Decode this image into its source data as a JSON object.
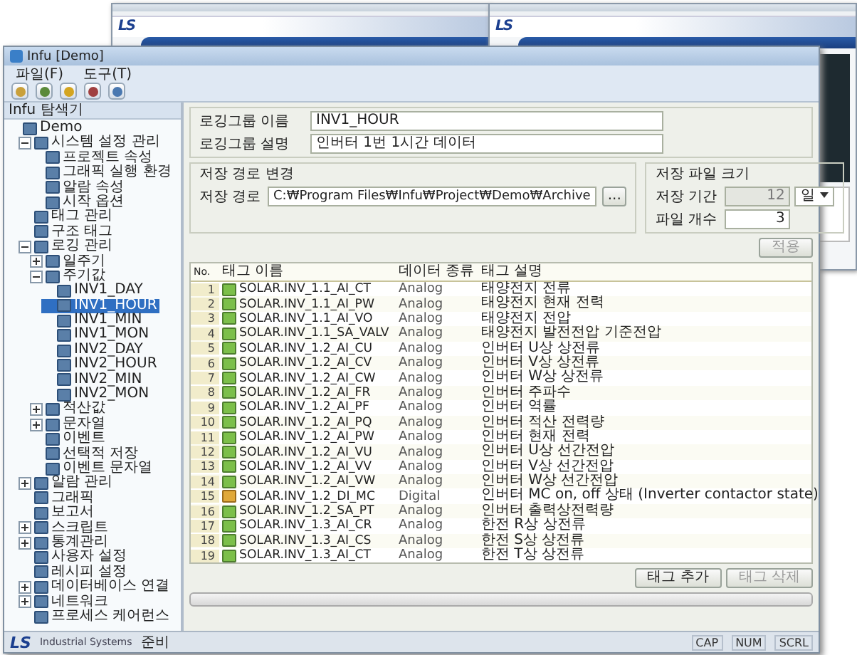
{
  "background_windows": [
    {
      "logo": "LS"
    },
    {
      "logo": "LS"
    }
  ],
  "main_window": {
    "title": "Infu [Demo]",
    "menu": [
      "파일(F)",
      "도구(T)"
    ],
    "explorer_title": "Infu 탐색기",
    "tree": [
      {
        "label": "Demo",
        "selected": false,
        "children": [
          {
            "label": "시스템 설정 관리",
            "selected": false,
            "expanded": true,
            "children": [
              {
                "label": "프로젝트 속성",
                "selected": false
              },
              {
                "label": "그래픽 실행 환경",
                "selected": false
              },
              {
                "label": "알람 속성",
                "selected": false
              },
              {
                "label": "시작 옵션",
                "selected": false
              }
            ]
          },
          {
            "label": "태그 관리",
            "selected": false
          },
          {
            "label": "구조 태그",
            "selected": false
          },
          {
            "label": "로깅 관리",
            "selected": false,
            "expanded": true,
            "children": [
              {
                "label": "일주기",
                "selected": false,
                "expanded": false
              },
              {
                "label": "주기값",
                "selected": false,
                "expanded": true,
                "children": [
                  {
                    "label": "INV1_DAY",
                    "selected": false
                  },
                  {
                    "label": "INV1_HOUR",
                    "selected": true
                  },
                  {
                    "label": "INV1_MIN",
                    "selected": false
                  },
                  {
                    "label": "INV1_MON",
                    "selected": false
                  },
                  {
                    "label": "INV2_DAY",
                    "selected": false
                  },
                  {
                    "label": "INV2_HOUR",
                    "selected": false
                  },
                  {
                    "label": "INV2_MIN",
                    "selected": false
                  },
                  {
                    "label": "INV2_MON",
                    "selected": false
                  }
                ]
              },
              {
                "label": "적산값",
                "selected": false,
                "expanded": false
              },
              {
                "label": "문자열",
                "selected": false,
                "expanded": false
              },
              {
                "label": "이벤트",
                "selected": false
              },
              {
                "label": "선택적 저장",
                "selected": false
              },
              {
                "label": "이벤트 문자열",
                "selected": false
              }
            ]
          },
          {
            "label": "알람 관리",
            "selected": false,
            "expanded": false
          },
          {
            "label": "그래픽",
            "selected": false
          },
          {
            "label": "보고서",
            "selected": false
          },
          {
            "label": "스크립트",
            "selected": false,
            "expanded": false
          },
          {
            "label": "통계관리",
            "selected": false,
            "expanded": false
          },
          {
            "label": "사용자 설정",
            "selected": false
          },
          {
            "label": "레시피 설정",
            "selected": false
          },
          {
            "label": "데이터베이스 연결",
            "selected": false,
            "expanded": false
          },
          {
            "label": "네트워크",
            "selected": false,
            "expanded": false
          },
          {
            "label": "프로세스 케어런스",
            "selected": false
          }
        ]
      }
    ],
    "form": {
      "group_name_label": "로깅그룹 이름",
      "group_name": "INV1_HOUR",
      "group_desc_label": "로깅그룹 설명",
      "group_desc": "인버터 1번 1시간 데이터",
      "path_section": "저장 경로 변경",
      "path_label": "저장 경로",
      "path": "C:₩Program Files₩Infu₩Project₩Demo₩Archive",
      "browse_button": "...",
      "size_section": "저장 파일 크기",
      "period_label": "저장 기간",
      "period": "12",
      "period_disabled": true,
      "period_unit": "일",
      "count_label": "파일 개수",
      "count": "3",
      "apply_button": {
        "label": "적용",
        "disabled": true
      }
    },
    "table": {
      "columns": [
        "No.",
        "태그 이름",
        "데이터 종류",
        "태그 설명"
      ],
      "rows": [
        {
          "no": "1",
          "name": "SOLAR.INV_1.1_AI_CT",
          "type": "Analog",
          "description": "태양전지 전류",
          "kind": "analog"
        },
        {
          "no": "2",
          "name": "SOLAR.INV_1.1_AI_PW",
          "type": "Analog",
          "description": "태양전지 현재 전력",
          "kind": "analog"
        },
        {
          "no": "3",
          "name": "SOLAR.INV_1.1_AI_VO",
          "type": "Analog",
          "description": "태양전지 전압",
          "kind": "analog"
        },
        {
          "no": "4",
          "name": "SOLAR.INV_1.1_SA_VALV",
          "type": "Analog",
          "description": "태양전지 발전전압 기준전압",
          "kind": "analog"
        },
        {
          "no": "5",
          "name": "SOLAR.INV_1.2_AI_CU",
          "type": "Analog",
          "description": "인버터 U상 상전류",
          "kind": "analog"
        },
        {
          "no": "6",
          "name": "SOLAR.INV_1.2_AI_CV",
          "type": "Analog",
          "description": "인버터 V상 상전류",
          "kind": "analog"
        },
        {
          "no": "7",
          "name": "SOLAR.INV_1.2_AI_CW",
          "type": "Analog",
          "description": "인버터 W상 상전류",
          "kind": "analog"
        },
        {
          "no": "8",
          "name": "SOLAR.INV_1.2_AI_FR",
          "type": "Analog",
          "description": "인버터 주파수",
          "kind": "analog"
        },
        {
          "no": "9",
          "name": "SOLAR.INV_1.2_AI_PF",
          "type": "Analog",
          "description": "인버터 역률",
          "kind": "analog"
        },
        {
          "no": "10",
          "name": "SOLAR.INV_1.2_AI_PQ",
          "type": "Analog",
          "description": "인버터 적산 전력량",
          "kind": "analog"
        },
        {
          "no": "11",
          "name": "SOLAR.INV_1.2_AI_PW",
          "type": "Analog",
          "description": "인버터 현재 전력",
          "kind": "analog"
        },
        {
          "no": "12",
          "name": "SOLAR.INV_1.2_AI_VU",
          "type": "Analog",
          "description": "인버터 U상 선간전압",
          "kind": "analog"
        },
        {
          "no": "13",
          "name": "SOLAR.INV_1.2_AI_VV",
          "type": "Analog",
          "description": "인버터 V상 선간전압",
          "kind": "analog"
        },
        {
          "no": "14",
          "name": "SOLAR.INV_1.2_AI_VW",
          "type": "Analog",
          "description": "인버터 W상 선간전압",
          "kind": "analog"
        },
        {
          "no": "15",
          "name": "SOLAR.INV_1.2_DI_MC",
          "type": "Digital",
          "description": "인버터 MC on, off 상태 (Inverter contactor state)",
          "kind": "digital"
        },
        {
          "no": "16",
          "name": "SOLAR.INV_1.2_SA_PT",
          "type": "Analog",
          "description": "인버터 출력상전력량",
          "kind": "analog"
        },
        {
          "no": "17",
          "name": "SOLAR.INV_1.3_AI_CR",
          "type": "Analog",
          "description": "한전 R상 상전류",
          "kind": "analog"
        },
        {
          "no": "18",
          "name": "SOLAR.INV_1.3_AI_CS",
          "type": "Analog",
          "description": "한전 S상 상전류",
          "kind": "analog"
        },
        {
          "no": "19",
          "name": "SOLAR.INV_1.3_AI_CT",
          "type": "Analog",
          "description": "한전 T상 상전류",
          "kind": "analog"
        }
      ]
    },
    "buttons": [
      {
        "label": "태그 추가",
        "disabled": false
      },
      {
        "label": "태그 삭제",
        "disabled": true
      }
    ],
    "status_bar": {
      "logo": "LS",
      "logo_caption": "Industrial Systems",
      "message": "준비",
      "indicators": [
        "CAP",
        "NUM",
        "SCRL"
      ]
    }
  }
}
